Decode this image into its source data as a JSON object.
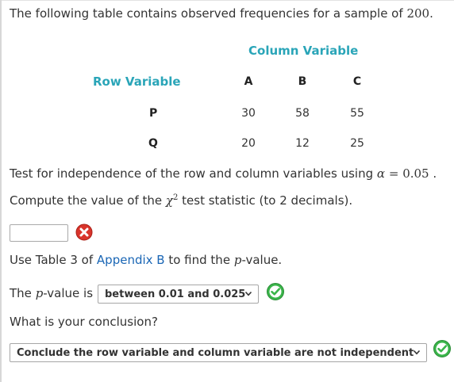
{
  "question": {
    "intro": "The following table contains observed frequencies for a sample of",
    "sample_size": "200",
    "intro_end": "."
  },
  "table": {
    "column_variable_label": "Column Variable",
    "row_variable_label": "Row Variable",
    "columns": [
      "A",
      "B",
      "C"
    ],
    "rows": [
      {
        "label": "P",
        "values": [
          "30",
          "58",
          "55"
        ]
      },
      {
        "label": "Q",
        "values": [
          "20",
          "12",
          "25"
        ]
      }
    ]
  },
  "test_line": {
    "text": "Test for independence of the row and column variables using",
    "alpha_symbol": "α",
    "equals": "=",
    "alpha_value": "0.05",
    "end": "."
  },
  "compute_line": {
    "before": "Compute the value of the",
    "chi": "χ",
    "superscript": "2",
    "after": "test statistic (to 2 decimals)."
  },
  "statistic_input": {
    "value": "",
    "status_icon": "x-circle-icon",
    "status": "incorrect"
  },
  "table_line": {
    "before": "Use Table 3 of",
    "link": "Appendix B",
    "middle": "to find the",
    "p": "p",
    "after": "-value."
  },
  "p_value_line": {
    "before": "The",
    "p": "p",
    "after": "-value is",
    "selected": "between 0.01 and 0.025",
    "status_icon": "check-circle-icon",
    "status": "correct"
  },
  "conclusion": {
    "question": "What is your conclusion?",
    "selected": "Conclude the row variable and column variable are not independent",
    "status_icon": "check-circle-icon",
    "status": "correct"
  },
  "colors": {
    "teal_label": "#2aa5b8",
    "link": "#1a66b5",
    "correct_green": "#3ab54a",
    "incorrect_red": "#d9342b"
  }
}
